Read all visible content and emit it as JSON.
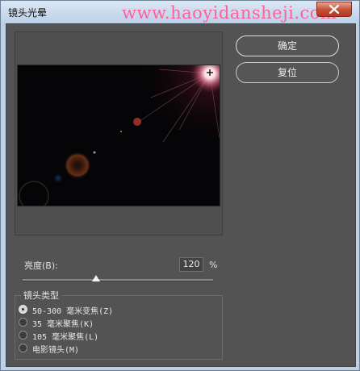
{
  "window": {
    "title": "镜头光晕"
  },
  "watermark": "www.haoyidansheji.com",
  "buttons": {
    "ok": "确定",
    "reset": "复位"
  },
  "brightness": {
    "label": "亮度(B):",
    "value": "120",
    "unit": "%",
    "level_percent": 120
  },
  "lens_type": {
    "title": "镜头类型",
    "options": [
      {
        "label": "50-300 毫米变焦(Z)",
        "selected": true
      },
      {
        "label": "35 毫米聚焦(K)",
        "selected": false
      },
      {
        "label": "105 毫米聚焦(L)",
        "selected": false
      },
      {
        "label": "电影镜头(M)",
        "selected": false
      }
    ]
  },
  "icons": [
    "close-icon",
    "flare-center-crosshair-icon"
  ]
}
